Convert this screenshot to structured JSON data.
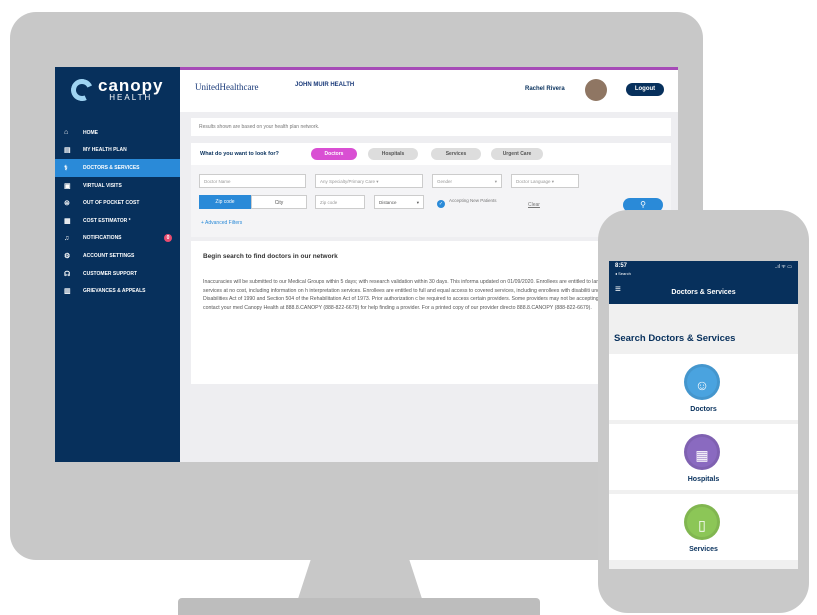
{
  "sidebar": {
    "brand": "canopy",
    "brand_sub": "HEALTH",
    "items": [
      {
        "icon": "home-icon",
        "label": "HOME"
      },
      {
        "icon": "document-icon",
        "label": "MY HEALTH PLAN"
      },
      {
        "icon": "stethoscope-icon",
        "label": "DOCTORS & SERVICES"
      },
      {
        "icon": "video-icon",
        "label": "VIRTUAL VISITS"
      },
      {
        "icon": "dollar-icon",
        "label": "OUT OF POCKET COST"
      },
      {
        "icon": "calculator-icon",
        "label": "COST ESTIMATOR",
        "suffix": "*"
      },
      {
        "icon": "bell-icon",
        "label": "NOTIFICATIONS",
        "badge": "0"
      },
      {
        "icon": "gear-icon",
        "label": "ACCOUNT SETTINGS"
      },
      {
        "icon": "headset-icon",
        "label": "CUSTOMER SUPPORT"
      },
      {
        "icon": "clipboard-icon",
        "label": "GRIEVANCES & APPEALS"
      }
    ]
  },
  "header": {
    "partner1": "UnitedHealthcare",
    "partner2": "JOHN MUIR HEALTH",
    "user_name": "Rachel Rivera",
    "logout": "Logout"
  },
  "notice": "Results shown are based on your health plan network.",
  "search": {
    "question": "What do you want to look for?",
    "categories": [
      "Doctors",
      "Hospitals",
      "Services",
      "Urgent Care"
    ],
    "doctor_name": "Doctor Name",
    "specialty": "Any Specialty/Primary Care",
    "gender": "Gender",
    "language": "Doctor Language",
    "zip_tab": "Zip code",
    "city_tab": "City",
    "zip_placeholder": "Zip code",
    "distance": "Distance",
    "accepting": "Accepting New Patients",
    "clear": "Clear",
    "advanced": "+ Advanced Filters"
  },
  "results": {
    "heading": "Begin search to find doctors in our network",
    "body": "Inaccuracies will be submitted to our Medical Groups within 5 days; with research validation within 30 days. This informa updated on 01/09/2020. Enrollees are entitled to language interpreter services at no cost, including information on h interpretation services. Enrollees are entitled to full and equal access to covered services, including enrollees with disabiliti under the Americans with Disabilities Act of 1990 and Section 504 of the Rehabilitation Act of 1973. Prior authorization c be required to access certain providers. Some providers may not be accepting new patients. Please contact your med Canopy Health at 888.8.CANOPY (888-822-6679) for help finding a provider. For a printed copy of our provider directo 888.8.CANOPY (888-822-6679)."
  },
  "phone": {
    "time": "8:57",
    "back": "◂ Search",
    "status": "..ıl ᯤ ▭",
    "title": "Doctors & Services",
    "section": "Search Doctors & Services",
    "tiles": [
      {
        "label": "Doctors",
        "icon": "doctor-icon",
        "color": "#4aa3df"
      },
      {
        "label": "Hospitals",
        "icon": "hospital-icon",
        "color": "#8a6ac0"
      },
      {
        "label": "Services",
        "icon": "clipboard-icon",
        "color": "#8cc657"
      }
    ]
  }
}
